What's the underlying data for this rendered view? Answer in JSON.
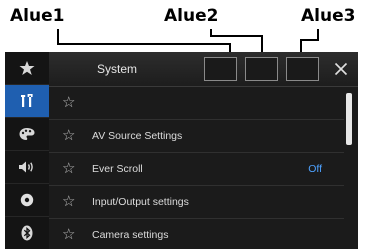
{
  "callouts": [
    "Alue1",
    "Alue2",
    "Alue3"
  ],
  "header": {
    "title": "System",
    "close_icon": "close-icon"
  },
  "sidebar": {
    "items": [
      {
        "icon": "star-icon"
      },
      {
        "icon": "tools-icon",
        "active": true
      },
      {
        "icon": "palette-icon"
      },
      {
        "icon": "speaker-icon"
      },
      {
        "icon": "disc-icon"
      },
      {
        "icon": "bluetooth-icon"
      }
    ]
  },
  "list": {
    "rows": [
      {
        "label": "",
        "value": ""
      },
      {
        "label": "AV Source Settings",
        "value": ""
      },
      {
        "label": "Ever Scroll",
        "value": "Off"
      },
      {
        "label": "Input/Output settings",
        "value": ""
      },
      {
        "label": "Camera settings",
        "value": ""
      }
    ]
  },
  "colors": {
    "active_sidebar": "#1f5fb0",
    "value_text": "#4ea2ff"
  }
}
